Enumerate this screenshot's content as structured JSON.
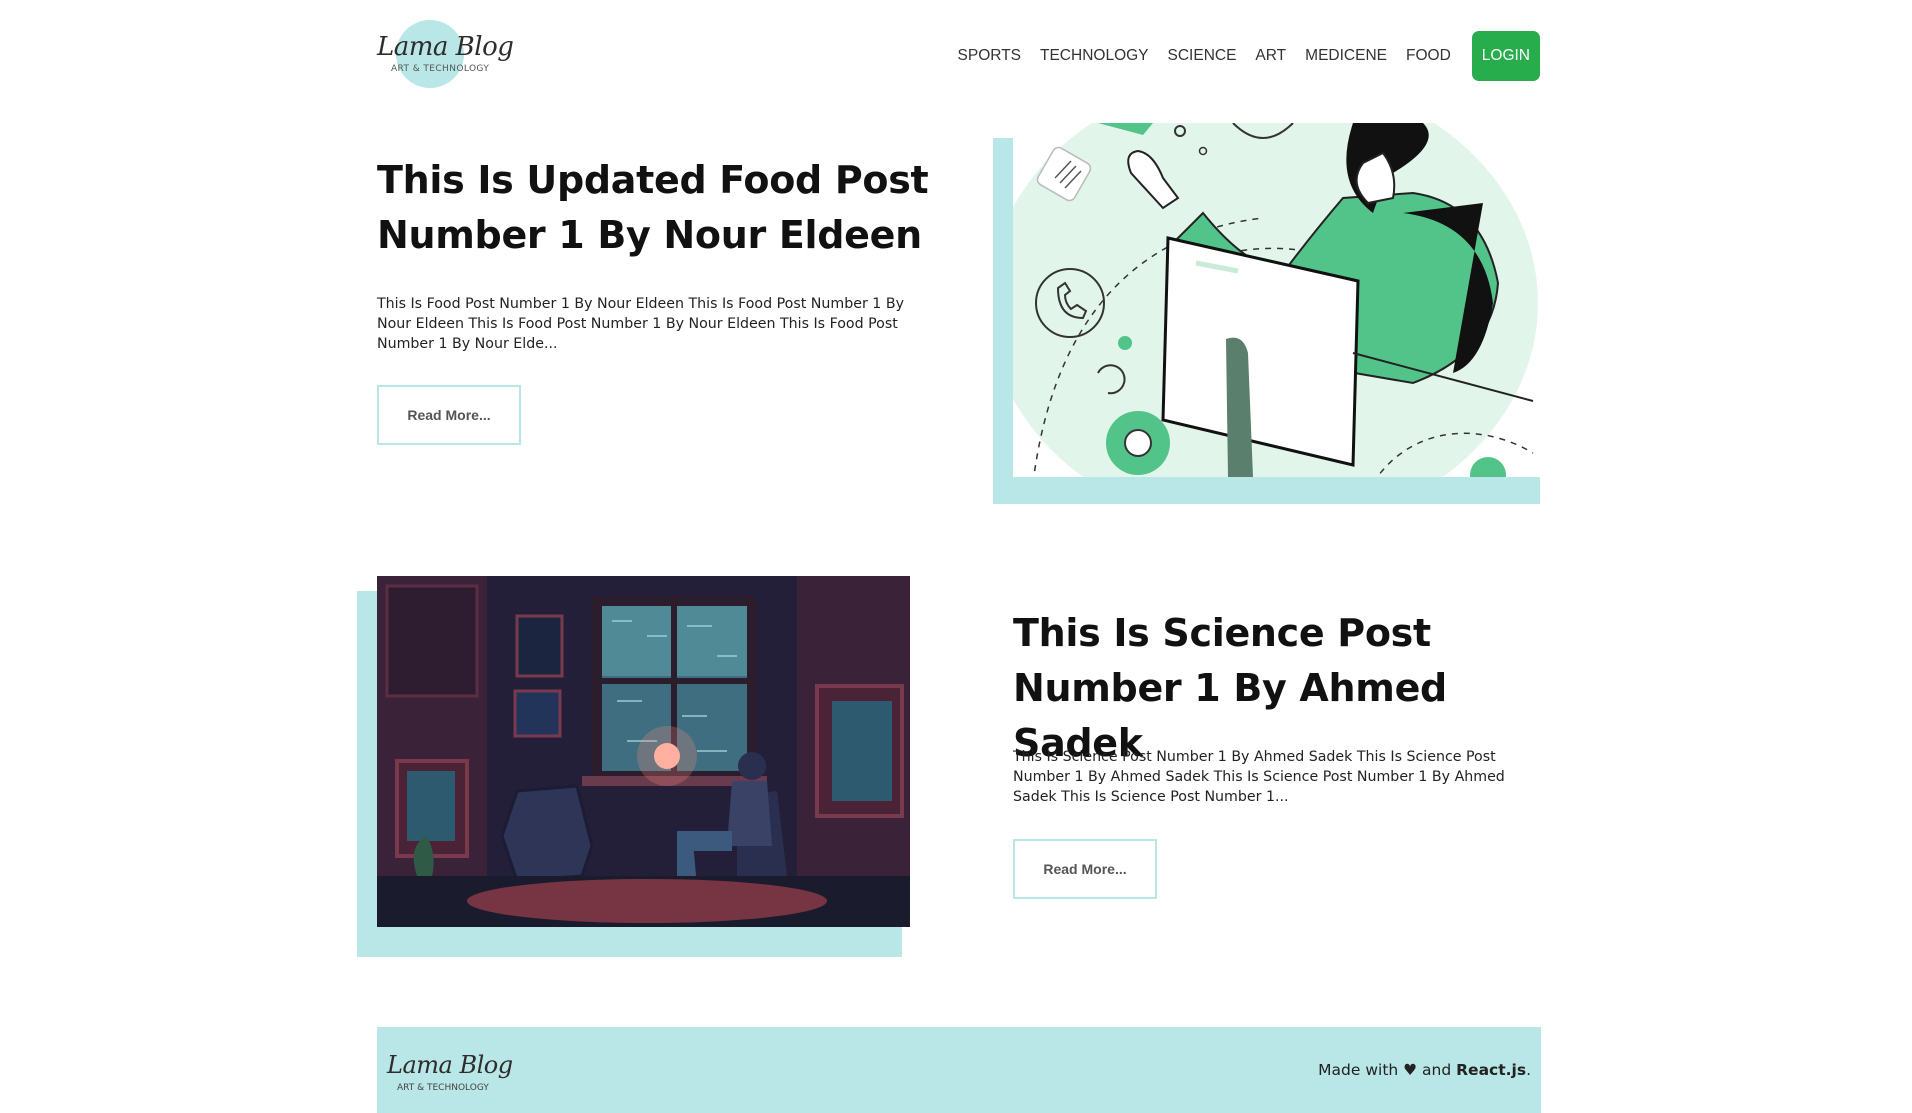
{
  "brand": {
    "name": "Lama Blog",
    "tagline": "ART & TECHNOLOGY"
  },
  "nav": {
    "links": [
      "SPORTS",
      "TECHNOLOGY",
      "SCIENCE",
      "ART",
      "MEDICENE",
      "FOOD"
    ],
    "login": "LOGIN"
  },
  "posts": [
    {
      "title": "This Is Updated Food Post Number 1 By Nour Eldeen",
      "desc": "This Is Food Post Number 1 By Nour Eldeen This Is Food Post Number 1 By Nour Eldeen This Is Food Post Number 1 By Nour Eldeen This Is Food Post Number 1 By Nour Elde...",
      "button": "Read More..."
    },
    {
      "title": "This Is Science Post Number 1 By Ahmed Sadek",
      "desc": "This Is Science Post Number 1 By Ahmed Sadek  This Is Science Post Number 1 By Ahmed Sadek  This Is Science Post Number 1 By Ahmed Sadek  This Is Science Post Number 1...",
      "button": "Read More..."
    }
  ],
  "footer": {
    "made_prefix": "Made with",
    "heart": "♥",
    "made_and": "and",
    "made_tech": "React.js",
    "made_suffix": "."
  },
  "colors": {
    "accent": "#b9e6e6",
    "login_bg": "#27ad4c",
    "illustration_green": "#52c48a"
  }
}
